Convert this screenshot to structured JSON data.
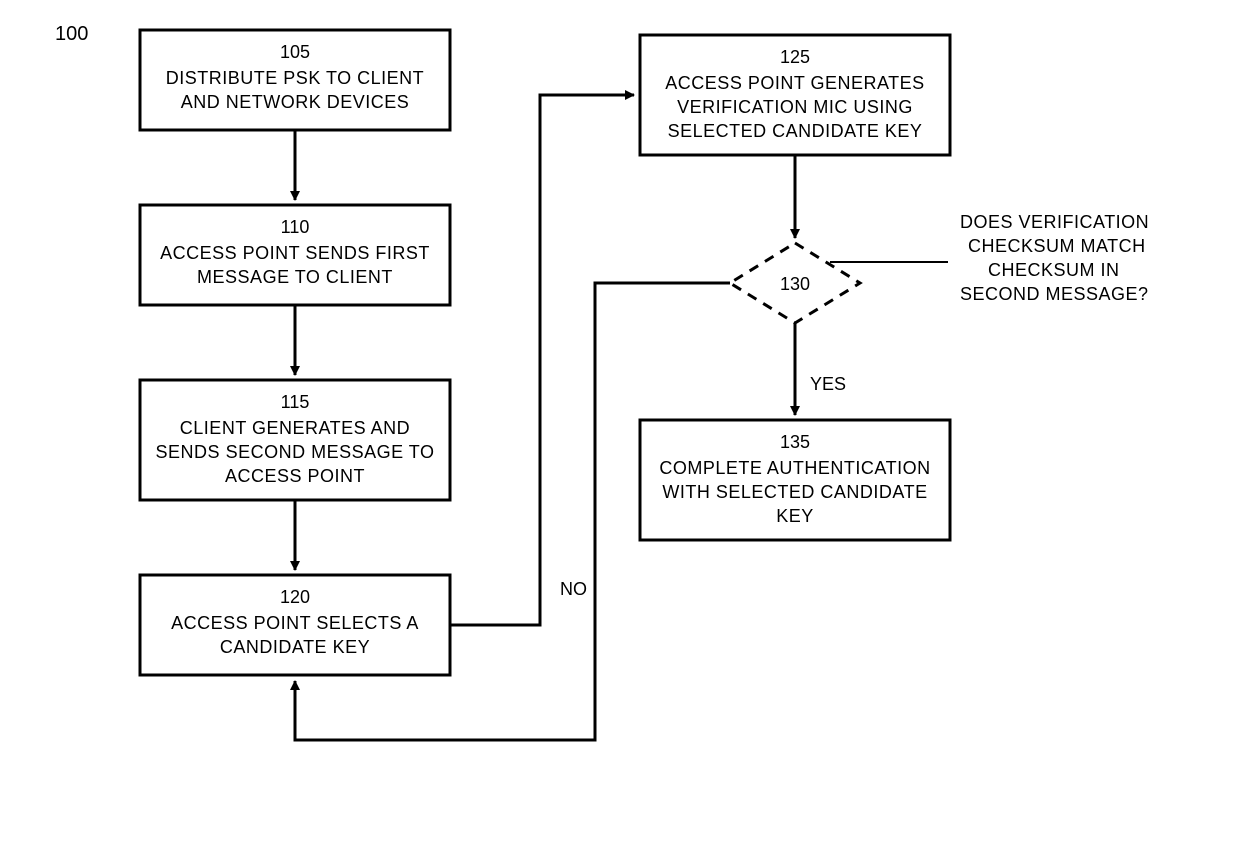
{
  "figure_label": "100",
  "boxes": {
    "b105": {
      "num": "105",
      "lines": [
        "DISTRIBUTE PSK TO CLIENT",
        "AND NETWORK DEVICES"
      ]
    },
    "b110": {
      "num": "110",
      "lines": [
        "ACCESS POINT SENDS FIRST",
        "MESSAGE TO CLIENT"
      ]
    },
    "b115": {
      "num": "115",
      "lines": [
        "CLIENT GENERATES AND",
        "SENDS SECOND MESSAGE TO",
        "ACCESS POINT"
      ]
    },
    "b120": {
      "num": "120",
      "lines": [
        "ACCESS POINT SELECTS A",
        "CANDIDATE KEY"
      ]
    },
    "b125": {
      "num": "125",
      "lines": [
        "ACCESS POINT GENERATES",
        "VERIFICATION MIC USING",
        "SELECTED CANDIDATE KEY"
      ]
    },
    "b135": {
      "num": "135",
      "lines": [
        "COMPLETE AUTHENTICATION",
        "WITH SELECTED CANDIDATE",
        "KEY"
      ]
    }
  },
  "decision": {
    "num": "130",
    "question": [
      "DOES VERIFICATION",
      "CHECKSUM MATCH",
      "CHECKSUM IN",
      "SECOND MESSAGE?"
    ]
  },
  "labels": {
    "yes": "YES",
    "no": "NO"
  }
}
